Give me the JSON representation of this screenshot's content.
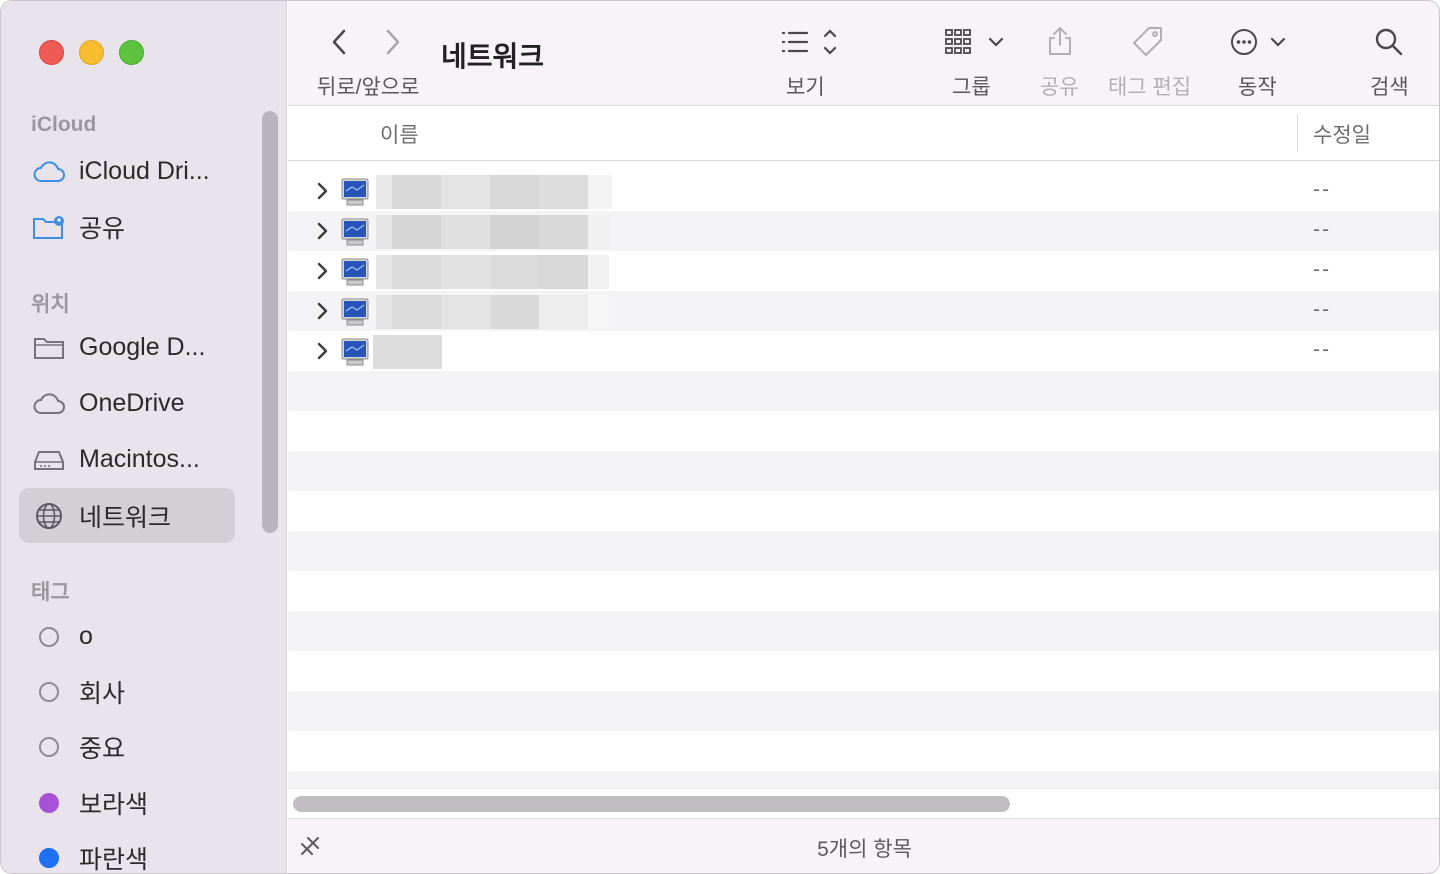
{
  "window": {
    "title": "네트워크"
  },
  "toolbar": {
    "nav_label": "뒤로/앞으로",
    "view_label": "보기",
    "group_label": "그룹",
    "share_label": "공유",
    "tag_edit_label": "태그 편집",
    "action_label": "동작",
    "search_label": "검색"
  },
  "sidebar": {
    "sections": {
      "icloud": "iCloud",
      "locations": "위치",
      "tags": "태그"
    },
    "icloud_items": [
      {
        "label": "iCloud Dri...",
        "icon": "cloud-icon"
      },
      {
        "label": "공유",
        "icon": "shared-folder-icon"
      }
    ],
    "location_items": [
      {
        "label": "Google D...",
        "icon": "folder-icon"
      },
      {
        "label": "OneDrive",
        "icon": "cloud-icon"
      },
      {
        "label": "Macintos...",
        "icon": "hard-drive-icon"
      },
      {
        "label": "네트워크",
        "icon": "globe-icon",
        "selected": true
      }
    ],
    "tag_items": [
      {
        "label": "o",
        "color": "none"
      },
      {
        "label": "회사",
        "color": "none"
      },
      {
        "label": "중요",
        "color": "none"
      },
      {
        "label": "보라색",
        "color": "#a752d6"
      },
      {
        "label": "파란색",
        "color": "#1e6ff2"
      }
    ]
  },
  "columns": {
    "name": "이름",
    "date_modified": "수정일"
  },
  "rows": [
    {
      "date": "--"
    },
    {
      "date": "--"
    },
    {
      "date": "--"
    },
    {
      "date": "--"
    },
    {
      "date": "--"
    }
  ],
  "status": {
    "item_count": "5개의 항목"
  }
}
